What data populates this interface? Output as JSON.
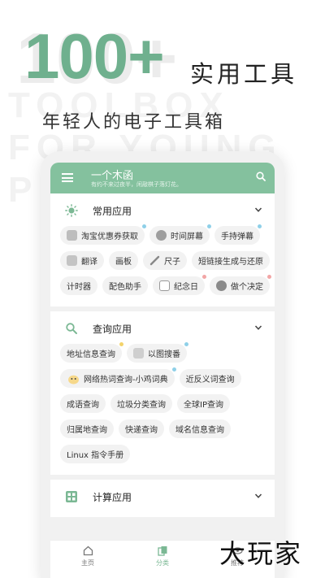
{
  "promo": {
    "bg_big": "100+",
    "bg_line1": "TOOLBOX",
    "bg_line2": "FOR YOUNG",
    "bg_line3": "P",
    "headline_number": "100+",
    "headline_label": "实用工具",
    "subtitle": "年轻人的电子工具箱"
  },
  "app": {
    "title": "一个木函",
    "motto": "有约不来过夜半，闲敲棋子落灯花。"
  },
  "sections": [
    {
      "title": "常用应用",
      "icon": "sun-icon",
      "tools": [
        {
          "label": "淘宝优惠券获取",
          "icon": "shopping-bag-icon",
          "dot": "#8fd0e8"
        },
        {
          "label": "时间屏幕",
          "icon": "clock-icon",
          "dot": "#8fd0e8"
        },
        {
          "label": "手持弹幕",
          "icon": "",
          "dot": "#8fd0e8"
        },
        {
          "label": "翻译",
          "icon": "translate-icon",
          "dot": ""
        },
        {
          "label": "画板",
          "icon": "",
          "dot": ""
        },
        {
          "label": "尺子",
          "icon": "ruler-icon",
          "dot": ""
        },
        {
          "label": "短链接生成与还原",
          "icon": "",
          "dot": ""
        },
        {
          "label": "计时器",
          "icon": "",
          "dot": ""
        },
        {
          "label": "配色助手",
          "icon": "",
          "dot": ""
        },
        {
          "label": "纪念日",
          "icon": "calendar-icon",
          "dot": "#f2a6a6"
        },
        {
          "label": "做个决定",
          "icon": "decision-icon",
          "dot": "#f2a6a6"
        }
      ]
    },
    {
      "title": "查询应用",
      "icon": "search-icon",
      "tools": [
        {
          "label": "地址信息查询",
          "icon": "",
          "dot": "#f3d36b"
        },
        {
          "label": "以图搜番",
          "icon": "image-search-icon",
          "dot": "#8fd0e8"
        },
        {
          "label": "网络热词查询-小鸡词典",
          "icon": "chick-icon",
          "dot": "#8fd0e8"
        },
        {
          "label": "近反义词查询",
          "icon": "",
          "dot": ""
        },
        {
          "label": "成语查询",
          "icon": "",
          "dot": ""
        },
        {
          "label": "垃圾分类查询",
          "icon": "",
          "dot": ""
        },
        {
          "label": "全球IP查询",
          "icon": "",
          "dot": ""
        },
        {
          "label": "归属地查询",
          "icon": "",
          "dot": ""
        },
        {
          "label": "快递查询",
          "icon": "",
          "dot": ""
        },
        {
          "label": "域名信息查询",
          "icon": "",
          "dot": ""
        },
        {
          "label": "Linux 指令手册",
          "icon": "",
          "dot": ""
        }
      ]
    },
    {
      "title": "计算应用",
      "icon": "calculator-icon",
      "tools": []
    }
  ],
  "nav": {
    "home": "主页",
    "category": "分类",
    "third": "推荐"
  },
  "watermark": "大玩家",
  "colors": {
    "accent": "#84c19e",
    "hero_green": "#6fb08e",
    "chip_bg": "#f2f2f2"
  }
}
